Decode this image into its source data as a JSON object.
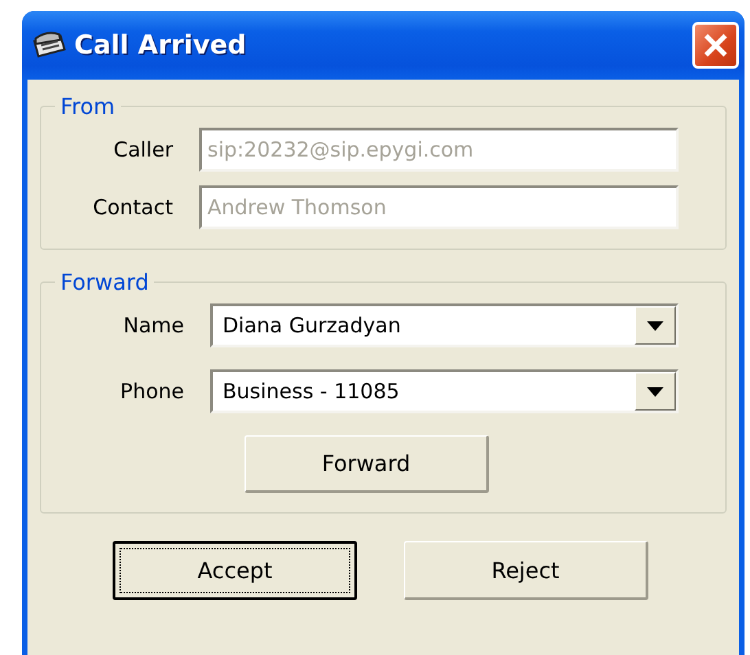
{
  "window": {
    "title": "Call Arrived"
  },
  "from": {
    "legend": "From",
    "fields": [
      {
        "label": "Caller",
        "value": "sip:20232@sip.epygi.com",
        "disabled": true
      },
      {
        "label": "Contact",
        "value": "Andrew Thomson",
        "disabled": true
      }
    ]
  },
  "forward": {
    "legend": "Forward",
    "fields": [
      {
        "label": "Name",
        "value": "Diana Gurzadyan"
      },
      {
        "label": "Phone",
        "value": "Business - 11085"
      }
    ],
    "button": "Forward"
  },
  "buttons": [
    {
      "label": "Accept",
      "focused": true
    },
    {
      "label": "Reject",
      "focused": false
    }
  ]
}
